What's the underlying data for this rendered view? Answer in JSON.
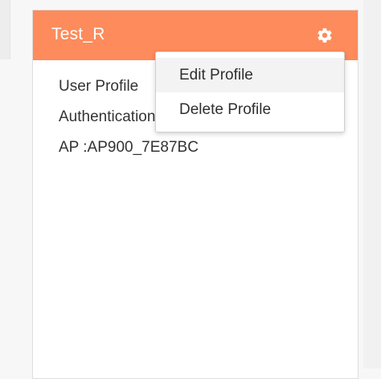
{
  "card": {
    "title": "Test_R",
    "settings_icon": "gear-icon",
    "lines": [
      "User Profile",
      "Authentication",
      "AP :AP900_7E87BC"
    ]
  },
  "menu": {
    "items": [
      "Edit Profile",
      "Delete Profile"
    ]
  },
  "colors": {
    "header": "#fd8b5b",
    "header_text": "#ffffff",
    "body_text": "#333333"
  }
}
